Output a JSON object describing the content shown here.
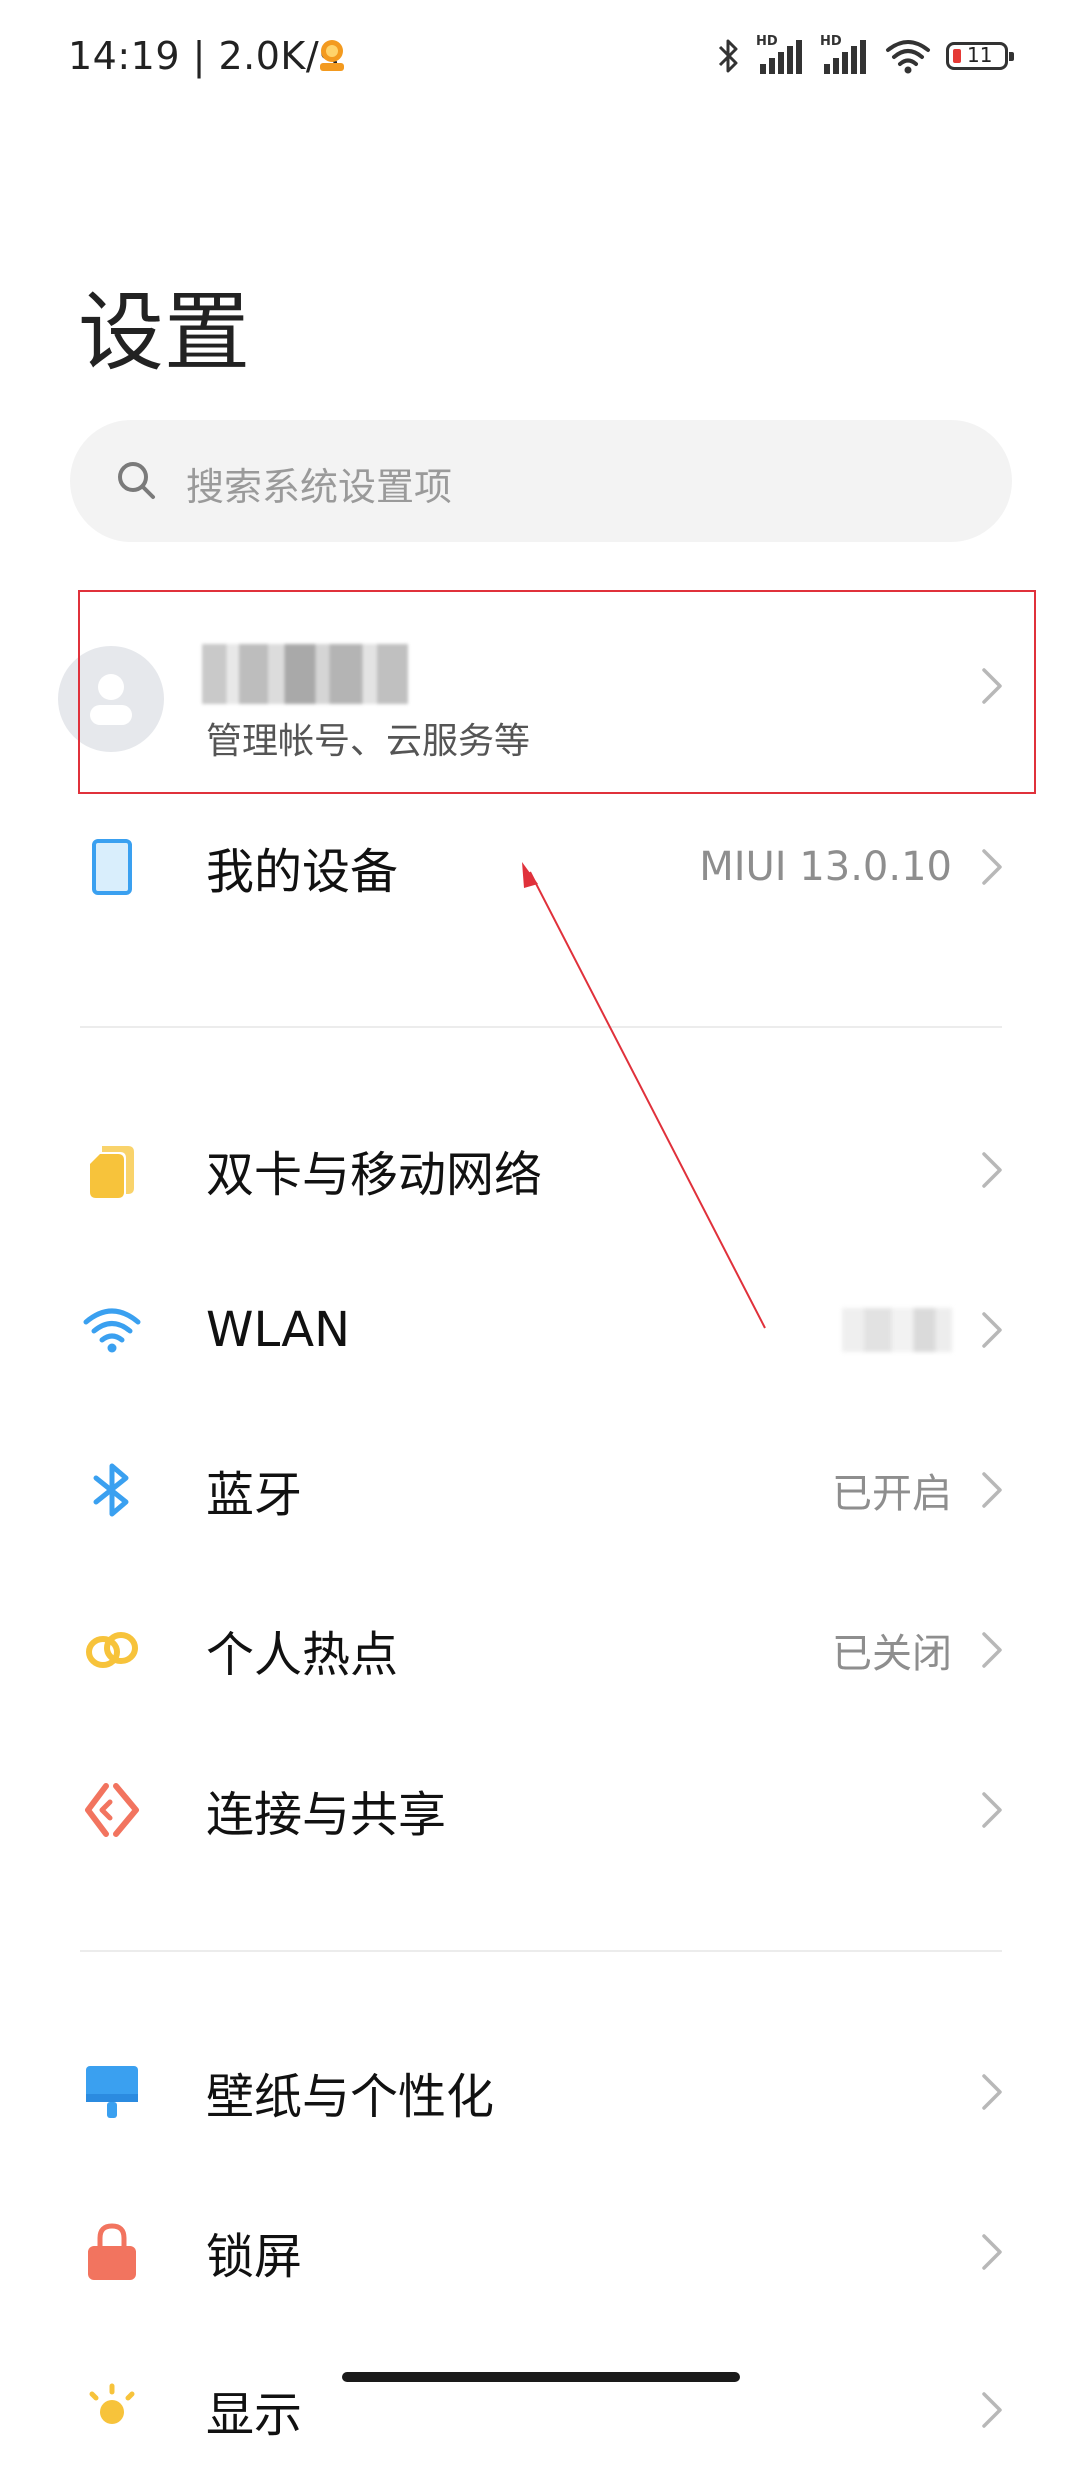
{
  "status_bar": {
    "time_speed": "14:19 | 2.0K/s",
    "hd_label_1": "HD",
    "hd_label_2": "HD",
    "battery_level": "11"
  },
  "page": {
    "title": "设置"
  },
  "search": {
    "placeholder": "搜索系统设置项"
  },
  "account": {
    "name": "",
    "subtitle": "管理帐号、云服务等"
  },
  "items": [
    {
      "label": "我的设备",
      "value": "MIUI 13.0.10",
      "icon": "device-icon"
    },
    {
      "label": "双卡与移动网络",
      "value": "",
      "icon": "sim-card-icon"
    },
    {
      "label": "WLAN",
      "value": "",
      "icon": "wifi-icon"
    },
    {
      "label": "蓝牙",
      "value": "已开启",
      "icon": "bluetooth-icon"
    },
    {
      "label": "个人热点",
      "value": "已关闭",
      "icon": "hotspot-icon"
    },
    {
      "label": "连接与共享",
      "value": "",
      "icon": "connection-share-icon"
    },
    {
      "label": "壁纸与个性化",
      "value": "",
      "icon": "wallpaper-icon"
    },
    {
      "label": "锁屏",
      "value": "",
      "icon": "lock-icon"
    },
    {
      "label": "显示",
      "value": "",
      "icon": "display-icon"
    }
  ],
  "colors": {
    "highlight_box": "#e0313b",
    "annotation_arrow": "#e0313b",
    "accent_blue": "#3aa0f0",
    "accent_yellow": "#f7c33b",
    "accent_orange": "#f2745f"
  }
}
